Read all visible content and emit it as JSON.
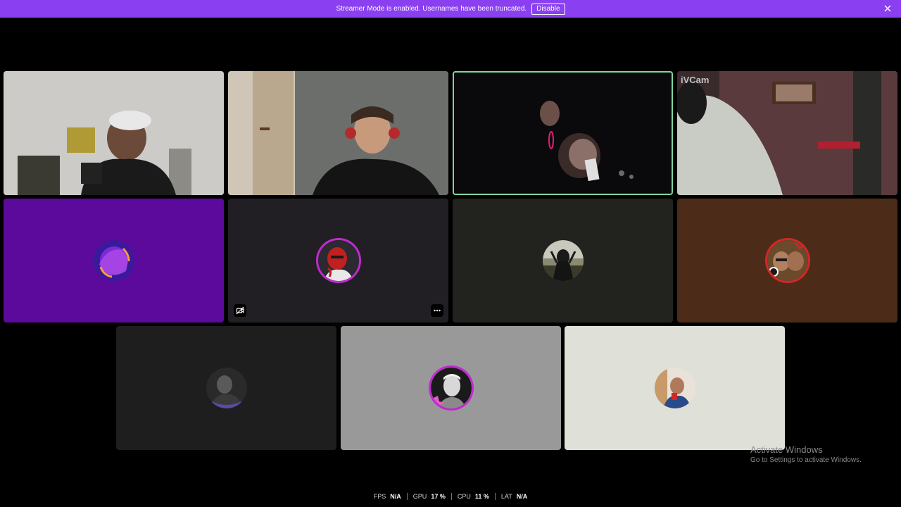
{
  "banner": {
    "message": "Streamer Mode is enabled. Usernames have been truncated.",
    "disable_label": "Disable",
    "close_icon": "close-icon",
    "color": "#8a3ff0"
  },
  "tiles": [
    {
      "kind": "video",
      "background": "#2a2a2a"
    },
    {
      "kind": "video",
      "background": "#3a3a3a"
    },
    {
      "kind": "video",
      "background": "#080808",
      "speaking": true
    },
    {
      "kind": "video",
      "background": "#3a2428",
      "overlay_text": "iVCam"
    },
    {
      "kind": "avatar",
      "background": "#5b0a9b"
    },
    {
      "kind": "avatar",
      "background": "#221f24",
      "mute_icon": "video-off-icon",
      "more_icon": "more-options-icon"
    },
    {
      "kind": "avatar",
      "background": "#22231e"
    },
    {
      "kind": "avatar",
      "background": "#4c2c18"
    },
    {
      "kind": "avatar",
      "background": "#1e1e1e"
    },
    {
      "kind": "avatar",
      "background": "#999999"
    },
    {
      "kind": "avatar",
      "background": "#dfe0d8"
    }
  ],
  "watermark": {
    "title": "Activate Windows",
    "subtitle": "Go to Settings to activate Windows."
  },
  "stats": {
    "fps_label": "FPS",
    "fps_value": "N/A",
    "gpu_label": "GPU",
    "gpu_value": "17 %",
    "cpu_label": "CPU",
    "cpu_value": "11 %",
    "lat_label": "LAT",
    "lat_value": "N/A"
  },
  "colors": {
    "speaking_outline": "#7fd6a0",
    "avatar_ring_pink": "#c02ad0",
    "avatar_ring_red": "#d02828"
  }
}
